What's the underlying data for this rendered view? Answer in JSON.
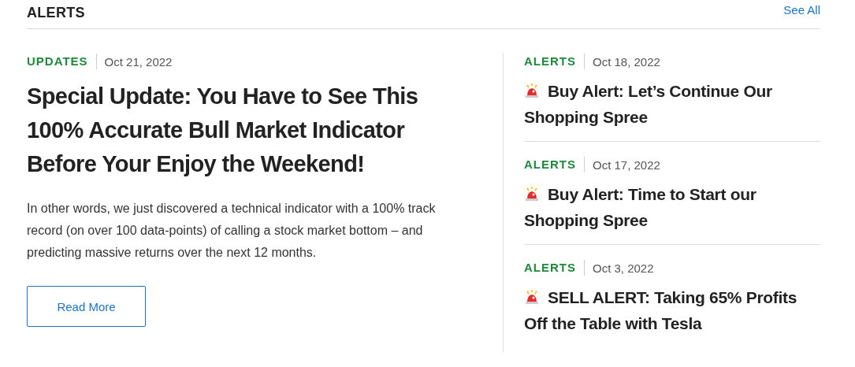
{
  "header": {
    "title": "ALERTS",
    "link": "See All"
  },
  "featured": {
    "category": "UPDATES",
    "date": "Oct 21, 2022",
    "title": "Special Update: You Have to See This 100% Accurate Bull Market Indicator Before Your Enjoy the Weekend!",
    "excerpt": "In other words, we just discovered a technical indicator with a 100% track record (on over 100 data-points) of calling a stock market bottom – and predicting massive returns over the next 12 months.",
    "button": "Read More"
  },
  "posts": [
    {
      "category": "ALERTS",
      "date": "Oct 18, 2022",
      "title": "Buy Alert: Let’s Continue Our Shopping Spree"
    },
    {
      "category": "ALERTS",
      "date": "Oct 17, 2022",
      "title": "Buy Alert: Time to Start our Shopping Spree"
    },
    {
      "category": "ALERTS",
      "date": "Oct 3, 2022",
      "title": "SELL ALERT: Taking 65% Profits Off the Table with Tesla"
    }
  ]
}
